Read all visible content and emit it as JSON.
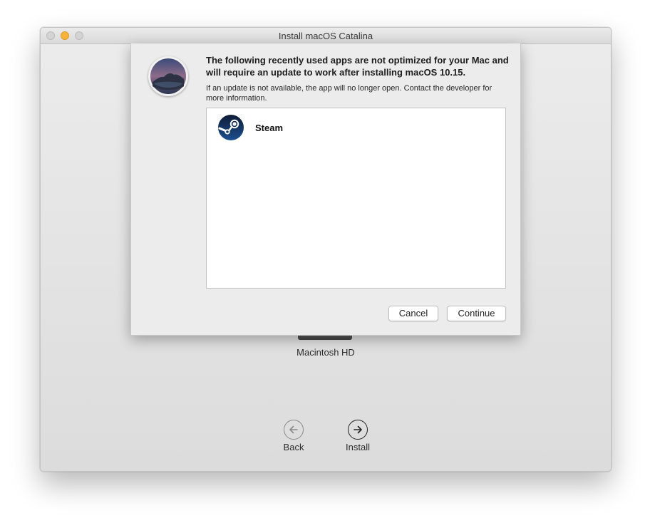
{
  "window": {
    "title": "Install macOS Catalina"
  },
  "installer": {
    "disk_label": "Macintosh HD",
    "back_label": "Back",
    "install_label": "Install"
  },
  "dialog": {
    "headline": "The following recently used apps are not optimized for your Mac and will require an update to work after installing macOS 10.15.",
    "subtext": "If an update is not available, the app will no longer open. Contact the developer for more information.",
    "apps": [
      {
        "name": "Steam",
        "icon": "steam-icon"
      }
    ],
    "cancel_label": "Cancel",
    "continue_label": "Continue"
  },
  "colors": {
    "minimize": "#f6b43c",
    "steam_dark": "#12294a"
  }
}
